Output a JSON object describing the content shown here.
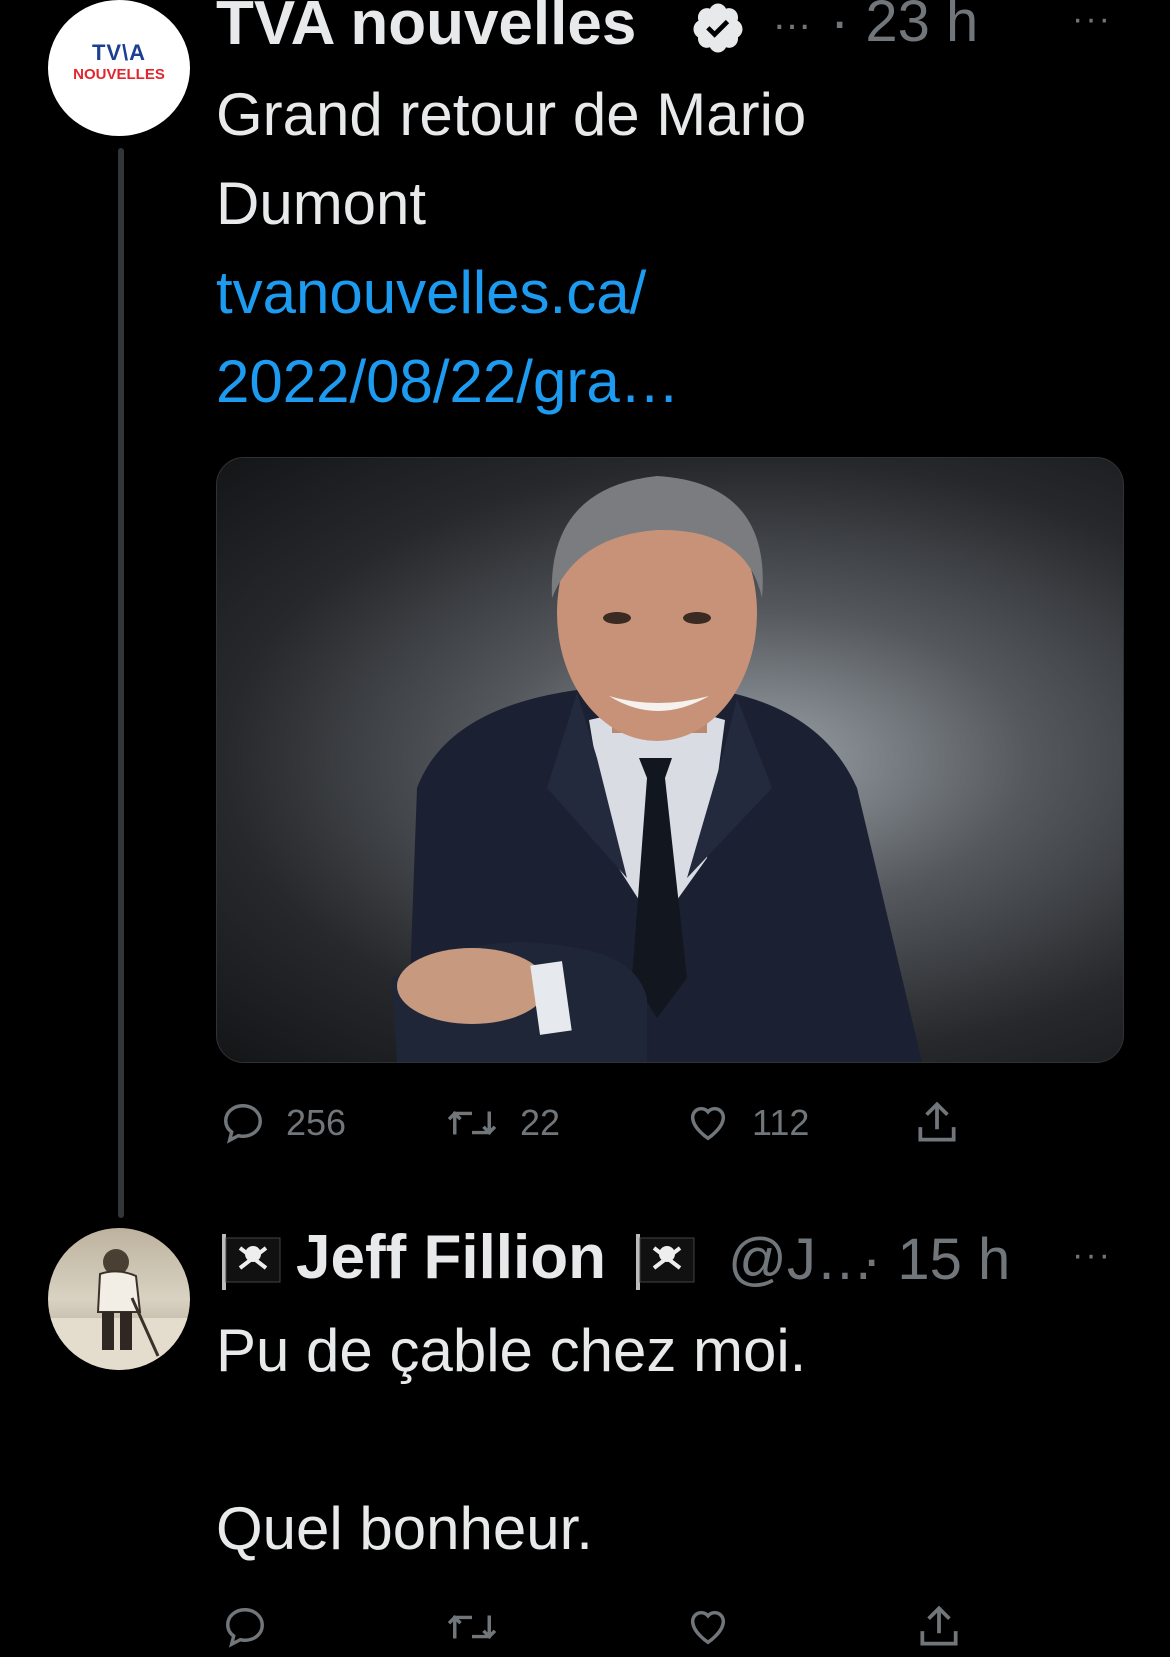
{
  "tweet1": {
    "avatar_line1": "TV\\A",
    "avatar_line2": "NOUVELLES",
    "author": "TVA nouvelles",
    "handle": "…",
    "time": "· 23 h",
    "more": "···",
    "text_line1": "Grand retour de Mario",
    "text_line2": "Dumont",
    "link_line1": "tvanouvelles.ca/",
    "link_line2": "2022/08/22/gra…",
    "replies": "256",
    "retweets": "22",
    "likes": "112"
  },
  "tweet2": {
    "author": "Jeff Fillion",
    "handle": "@J…",
    "time": "· 15 h",
    "more": "···",
    "text_line1": "Pu de çable chez moi.",
    "text_line2": "Quel bonheur."
  },
  "colors": {
    "background": "#000000",
    "text": "#e7e9ea",
    "muted": "#71767b",
    "link": "#1d9bf0",
    "tva_red": "#e2262c",
    "tva_blue": "#1c3f94"
  }
}
